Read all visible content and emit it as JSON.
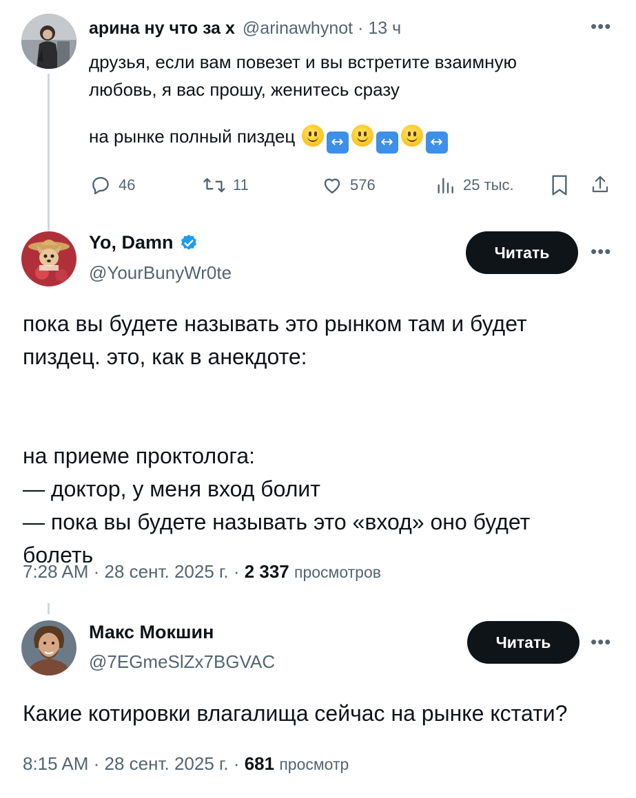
{
  "tweet1": {
    "name": "арина ну что за х",
    "handle": "@arinawhynot",
    "sep": "·",
    "time": "13 ч",
    "text_line1": "друзья, если вам повезет и вы встретите взаимную",
    "text_line2": "любовь, я вас прошу, женитесь сразу",
    "text_line3": "на рынке полный пиздец",
    "emoji_sequence": [
      "slightly-smiling-face",
      "left-right-arrow",
      "slightly-smiling-face",
      "left-right-arrow",
      "slightly-smiling-face",
      "left-right-arrow"
    ],
    "stats": {
      "replies": "46",
      "retweets": "11",
      "likes": "576",
      "views": "25 тыс."
    }
  },
  "tweet2": {
    "name": "Yo, Damn",
    "handle": "@YourBunyWr0te",
    "verified": true,
    "follow_label": "Читать",
    "text": "пока вы будете называть это рынком там и будет\nпиздец. это, как в анекдоте:\n\n\nна приеме проктолога:\n— доктор, у меня вход болит\n— пока вы будете называть это «вход» оно будет\nболеть",
    "time": "7:28 AM",
    "date": "28 сент. 2025 г.",
    "views_count": "2 337",
    "views_label": "просмотров"
  },
  "tweet3": {
    "name": "Макс Мокшин",
    "handle": "@7EGmeSlZx7BGVAC",
    "follow_label": "Читать",
    "text": "Какие котировки влагалища сейчас на рынке кстати?",
    "time": "8:15 AM",
    "date": "28 сент. 2025 г.",
    "views_count": "681",
    "views_label": "просмотр"
  },
  "colors": {
    "accent": "#1d9bf0",
    "text": "#0f1419",
    "secondary": "#536471",
    "button": "#0f1419"
  }
}
